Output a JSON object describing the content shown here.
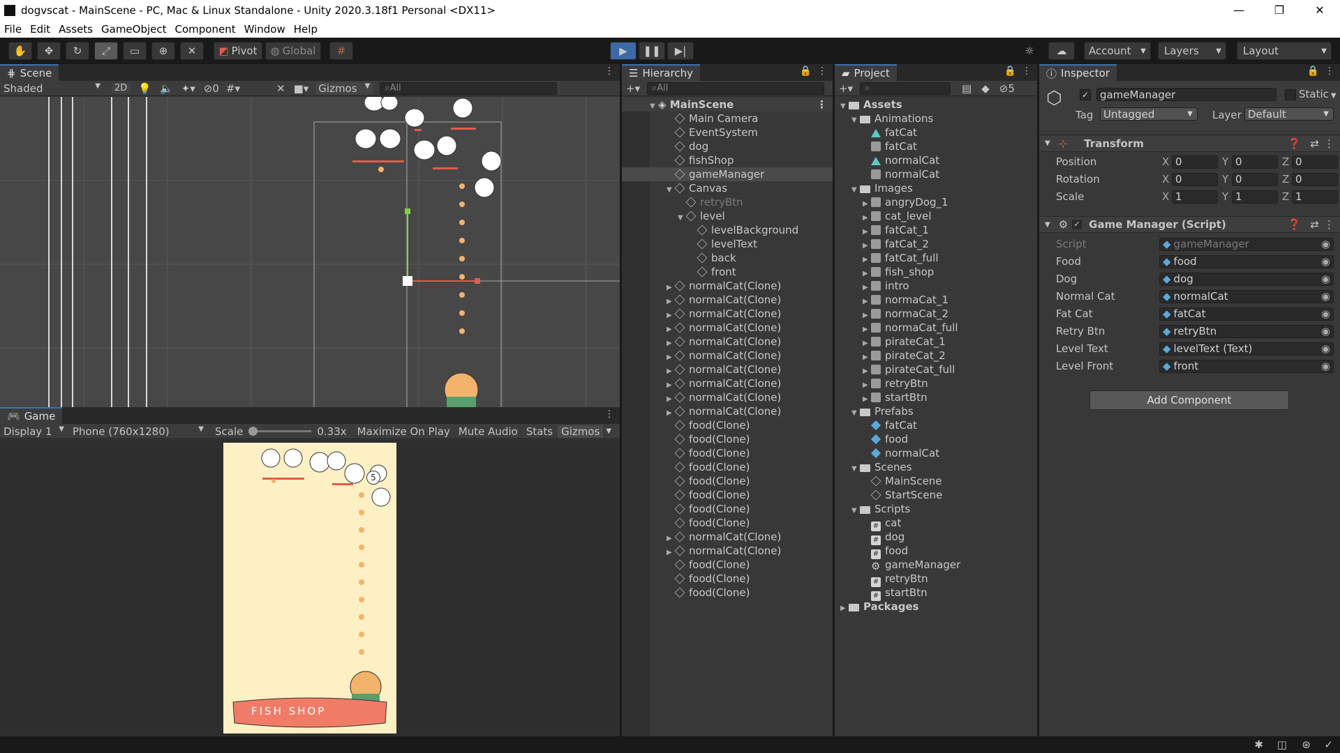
{
  "window": {
    "title": "dogvscat - MainScene - PC, Mac & Linux Standalone - Unity 2020.3.18f1 Personal <DX11>",
    "controls": [
      "—",
      "❐",
      "✕"
    ]
  },
  "menu": [
    "File",
    "Edit",
    "Assets",
    "GameObject",
    "Component",
    "Window",
    "Help"
  ],
  "toolbar": {
    "pivot": "Pivot",
    "global": "Global",
    "account": "Account",
    "layers": "Layers",
    "layout": "Layout"
  },
  "scene": {
    "tab": "Scene",
    "shading": "Shaded",
    "mode2d": "2D",
    "hidden_count": "0",
    "gizmos": "Gizmos",
    "search_placeholder": "All"
  },
  "game": {
    "tab": "Game",
    "display": "Display 1",
    "resolution": "Phone (760x1280)",
    "scale_label": "Scale",
    "scale_value": "0.33x",
    "maximize": "Maximize On Play",
    "mute": "Mute Audio",
    "stats": "Stats",
    "gizmos": "Gizmos",
    "counter": "5",
    "shop_sign": "FISH SHOP"
  },
  "hierarchy": {
    "tab": "Hierarchy",
    "search_placeholder": "All",
    "scene": "MainScene",
    "items": [
      {
        "label": "Main Camera",
        "indent": 1,
        "expand": ""
      },
      {
        "label": "EventSystem",
        "indent": 1,
        "expand": ""
      },
      {
        "label": "dog",
        "indent": 1,
        "expand": ""
      },
      {
        "label": "fishShop",
        "indent": 1,
        "expand": ""
      },
      {
        "label": "gameManager",
        "indent": 1,
        "expand": "",
        "selected": true
      },
      {
        "label": "Canvas",
        "indent": 1,
        "expand": "▼"
      },
      {
        "label": "retryBtn",
        "indent": 2,
        "expand": "",
        "dim": true
      },
      {
        "label": "level",
        "indent": 2,
        "expand": "▼"
      },
      {
        "label": "levelBackground",
        "indent": 3,
        "expand": ""
      },
      {
        "label": "levelText",
        "indent": 3,
        "expand": ""
      },
      {
        "label": "back",
        "indent": 3,
        "expand": ""
      },
      {
        "label": "front",
        "indent": 3,
        "expand": ""
      },
      {
        "label": "normalCat(Clone)",
        "indent": 1,
        "expand": "▶"
      },
      {
        "label": "normalCat(Clone)",
        "indent": 1,
        "expand": "▶"
      },
      {
        "label": "normalCat(Clone)",
        "indent": 1,
        "expand": "▶"
      },
      {
        "label": "normalCat(Clone)",
        "indent": 1,
        "expand": "▶"
      },
      {
        "label": "normalCat(Clone)",
        "indent": 1,
        "expand": "▶"
      },
      {
        "label": "normalCat(Clone)",
        "indent": 1,
        "expand": "▶"
      },
      {
        "label": "normalCat(Clone)",
        "indent": 1,
        "expand": "▶"
      },
      {
        "label": "normalCat(Clone)",
        "indent": 1,
        "expand": "▶"
      },
      {
        "label": "normalCat(Clone)",
        "indent": 1,
        "expand": "▶"
      },
      {
        "label": "normalCat(Clone)",
        "indent": 1,
        "expand": "▶"
      },
      {
        "label": "food(Clone)",
        "indent": 1,
        "expand": ""
      },
      {
        "label": "food(Clone)",
        "indent": 1,
        "expand": ""
      },
      {
        "label": "food(Clone)",
        "indent": 1,
        "expand": ""
      },
      {
        "label": "food(Clone)",
        "indent": 1,
        "expand": ""
      },
      {
        "label": "food(Clone)",
        "indent": 1,
        "expand": ""
      },
      {
        "label": "food(Clone)",
        "indent": 1,
        "expand": ""
      },
      {
        "label": "food(Clone)",
        "indent": 1,
        "expand": ""
      },
      {
        "label": "food(Clone)",
        "indent": 1,
        "expand": ""
      },
      {
        "label": "normalCat(Clone)",
        "indent": 1,
        "expand": "▶"
      },
      {
        "label": "normalCat(Clone)",
        "indent": 1,
        "expand": "▶"
      },
      {
        "label": "food(Clone)",
        "indent": 1,
        "expand": ""
      },
      {
        "label": "food(Clone)",
        "indent": 1,
        "expand": ""
      },
      {
        "label": "food(Clone)",
        "indent": 1,
        "expand": ""
      }
    ]
  },
  "project": {
    "tab": "Project",
    "hidden_count": "5",
    "items": [
      {
        "label": "Assets",
        "indent": 0,
        "expand": "▼",
        "icon": "folder",
        "bold": true
      },
      {
        "label": "Animations",
        "indent": 1,
        "expand": "▼",
        "icon": "folder"
      },
      {
        "label": "fatCat",
        "indent": 2,
        "expand": "",
        "icon": "anim"
      },
      {
        "label": "fatCat",
        "indent": 2,
        "expand": "",
        "icon": "img"
      },
      {
        "label": "normalCat",
        "indent": 2,
        "expand": "",
        "icon": "anim"
      },
      {
        "label": "normalCat",
        "indent": 2,
        "expand": "",
        "icon": "img"
      },
      {
        "label": "Images",
        "indent": 1,
        "expand": "▼",
        "icon": "folder"
      },
      {
        "label": "angryDog_1",
        "indent": 2,
        "expand": "▶",
        "icon": "img"
      },
      {
        "label": "cat_level",
        "indent": 2,
        "expand": "▶",
        "icon": "img"
      },
      {
        "label": "fatCat_1",
        "indent": 2,
        "expand": "▶",
        "icon": "img"
      },
      {
        "label": "fatCat_2",
        "indent": 2,
        "expand": "▶",
        "icon": "img"
      },
      {
        "label": "fatCat_full",
        "indent": 2,
        "expand": "▶",
        "icon": "img"
      },
      {
        "label": "fish_shop",
        "indent": 2,
        "expand": "▶",
        "icon": "img"
      },
      {
        "label": "intro",
        "indent": 2,
        "expand": "▶",
        "icon": "img"
      },
      {
        "label": "normaCat_1",
        "indent": 2,
        "expand": "▶",
        "icon": "img"
      },
      {
        "label": "normaCat_2",
        "indent": 2,
        "expand": "▶",
        "icon": "img"
      },
      {
        "label": "normaCat_full",
        "indent": 2,
        "expand": "▶",
        "icon": "img"
      },
      {
        "label": "pirateCat_1",
        "indent": 2,
        "expand": "▶",
        "icon": "img"
      },
      {
        "label": "pirateCat_2",
        "indent": 2,
        "expand": "▶",
        "icon": "img"
      },
      {
        "label": "pirateCat_full",
        "indent": 2,
        "expand": "▶",
        "icon": "img"
      },
      {
        "label": "retryBtn",
        "indent": 2,
        "expand": "▶",
        "icon": "img"
      },
      {
        "label": "startBtn",
        "indent": 2,
        "expand": "▶",
        "icon": "img"
      },
      {
        "label": "Prefabs",
        "indent": 1,
        "expand": "▼",
        "icon": "folder"
      },
      {
        "label": "fatCat",
        "indent": 2,
        "expand": "",
        "icon": "prefab"
      },
      {
        "label": "food",
        "indent": 2,
        "expand": "",
        "icon": "prefab"
      },
      {
        "label": "normalCat",
        "indent": 2,
        "expand": "",
        "icon": "prefab"
      },
      {
        "label": "Scenes",
        "indent": 1,
        "expand": "▼",
        "icon": "folder"
      },
      {
        "label": "MainScene",
        "indent": 2,
        "expand": "",
        "icon": "scene"
      },
      {
        "label": "StartScene",
        "indent": 2,
        "expand": "",
        "icon": "scene"
      },
      {
        "label": "Scripts",
        "indent": 1,
        "expand": "▼",
        "icon": "folder"
      },
      {
        "label": "cat",
        "indent": 2,
        "expand": "",
        "icon": "script"
      },
      {
        "label": "dog",
        "indent": 2,
        "expand": "",
        "icon": "script"
      },
      {
        "label": "food",
        "indent": 2,
        "expand": "",
        "icon": "script"
      },
      {
        "label": "gameManager",
        "indent": 2,
        "expand": "",
        "icon": "gear"
      },
      {
        "label": "retryBtn",
        "indent": 2,
        "expand": "",
        "icon": "script"
      },
      {
        "label": "startBtn",
        "indent": 2,
        "expand": "",
        "icon": "script"
      },
      {
        "label": "Packages",
        "indent": 0,
        "expand": "▶",
        "icon": "folder",
        "bold": true
      }
    ]
  },
  "inspector": {
    "tab": "Inspector",
    "object_name": "gameManager",
    "static_label": "Static",
    "tag_label": "Tag",
    "tag_value": "Untagged",
    "layer_label": "Layer",
    "layer_value": "Default",
    "transform": {
      "title": "Transform",
      "rows": [
        {
          "label": "Position",
          "x": "0",
          "y": "0",
          "z": "0"
        },
        {
          "label": "Rotation",
          "x": "0",
          "y": "0",
          "z": "0"
        },
        {
          "label": "Scale",
          "x": "1",
          "y": "1",
          "z": "1"
        }
      ]
    },
    "script_component": {
      "title": "Game Manager (Script)",
      "fields": [
        {
          "label": "Script",
          "value": "gameManager",
          "dim": true
        },
        {
          "label": "Food",
          "value": "food"
        },
        {
          "label": "Dog",
          "value": "dog"
        },
        {
          "label": "Normal Cat",
          "value": "normalCat"
        },
        {
          "label": "Fat Cat",
          "value": "fatCat"
        },
        {
          "label": "Retry Btn",
          "value": "retryBtn"
        },
        {
          "label": "Level Text",
          "value": "levelText (Text)"
        },
        {
          "label": "Level Front",
          "value": "front"
        }
      ]
    },
    "add_component": "Add Component"
  },
  "colors": {
    "accent": "#3a72b0",
    "play_active": "#3d6aa6",
    "game_bg": "#fdf0c4",
    "shop_red": "#f07c67"
  }
}
